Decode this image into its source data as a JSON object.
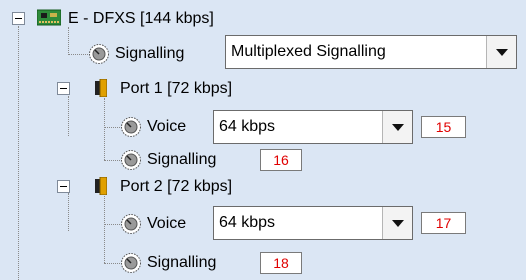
{
  "tree": {
    "card": {
      "label": "E - DFXS [144 kbps]",
      "icon": "circuit-board-icon"
    },
    "card_signalling": {
      "label": "Signalling",
      "icon": "knob-icon",
      "select_value": "Multiplexed Signalling"
    },
    "ports": [
      {
        "label": "Port 1 [72 kbps]",
        "icon": "port-connector-icon",
        "voice": {
          "label": "Voice",
          "select_value": "64 kbps",
          "channel": "15"
        },
        "signalling": {
          "label": "Signalling",
          "channel": "16"
        }
      },
      {
        "label": "Port 2 [72 kbps]",
        "icon": "port-connector-icon",
        "voice": {
          "label": "Voice",
          "select_value": "64 kbps",
          "channel": "17"
        },
        "signalling": {
          "label": "Signalling",
          "channel": "18"
        }
      }
    ]
  },
  "colors": {
    "background": "#dbe6f4",
    "channel_text": "#e00000",
    "board_icon": "#2e8b3a"
  }
}
